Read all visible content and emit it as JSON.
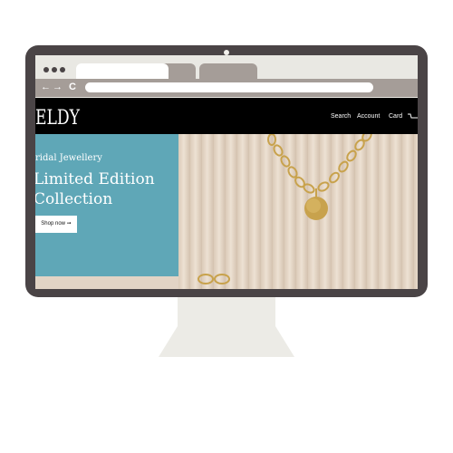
{
  "browser": {
    "back_icon": "back-arrow-icon",
    "forward_icon": "forward-arrow-icon",
    "reload_icon": "reload-icon",
    "back_glyph": "←",
    "forward_glyph": "→",
    "reload_glyph": "C"
  },
  "site": {
    "logo": "ELDY",
    "nav": {
      "search": "Search",
      "account": "Account",
      "card": "Card"
    },
    "hero": {
      "subtitle": "ridal Jewellery",
      "headline_line1": "Limited Edition",
      "headline_line2": "Collection",
      "button_label": "Shop now ➞"
    }
  },
  "colors": {
    "monitor_frame": "#4a4446",
    "browser_chrome": "#e9e8e3",
    "tab_inactive": "#a59d98",
    "site_header": "#000000",
    "hero_teal": "#5fa7b7",
    "hero_beige": "#e6d6c6",
    "gold": "#c8a24c"
  }
}
